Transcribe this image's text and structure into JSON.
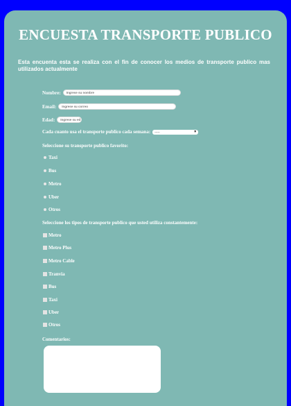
{
  "title": "ENCUESTA TRANSPORTE PUBLICO",
  "intro": "Esta encuenta esta se realiza con el fin de conocer los medios de transporte publico mas utilizados actualmente",
  "fields": {
    "name_label": "Nombre:",
    "name_placeholder": "Ingrese su nombre",
    "email_label": "Email:",
    "email_placeholder": "Ingrese su correo",
    "age_label": "Edad:",
    "age_placeholder": "Ingrese su ed"
  },
  "frequency": {
    "label": "Cada cuanto usa el transporte publico cada semana:",
    "selected": "-----"
  },
  "favorite": {
    "question": "Seleccione su transporte publico favorito:",
    "options": [
      "Taxi",
      "Bus",
      "Metro",
      "Uber",
      "Otros"
    ]
  },
  "types": {
    "question": "Seleccione los tipos de transporte publico que usted utiliza constantemente:",
    "options": [
      "Metro",
      "Metro Plus",
      "Metro Cable",
      "Tranvia",
      "Bus",
      "Taxi",
      "Uber",
      "Otros"
    ]
  },
  "comments": {
    "label": "Comentarios:"
  }
}
